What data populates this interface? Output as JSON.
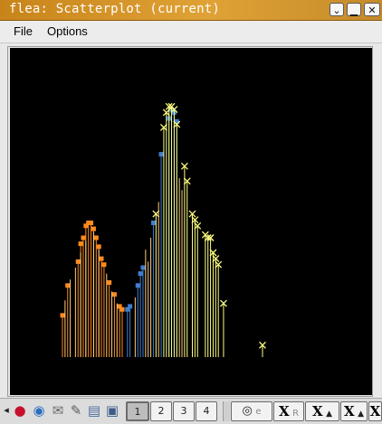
{
  "window": {
    "title": "flea: Scatterplot (current)",
    "buttons": [
      "help",
      "minimize",
      "maximize",
      "close"
    ]
  },
  "menu": {
    "file": "File",
    "options": "Options"
  },
  "chart_data": {
    "type": "scatter",
    "style": "points-with-drop-lines",
    "background": "#000000",
    "baseline_y": 0,
    "xlim": [
      0,
      100
    ],
    "ylim": [
      0,
      100
    ],
    "series": [
      {
        "group": "orange",
        "color": "#ff8a1f",
        "marker": "square",
        "points": [
          [
            0,
            14
          ],
          [
            2,
            24
          ],
          [
            6,
            32
          ],
          [
            7,
            38
          ],
          [
            8,
            40
          ],
          [
            9,
            44
          ],
          [
            10,
            45
          ],
          [
            11,
            45
          ],
          [
            12,
            43
          ],
          [
            13,
            40
          ],
          [
            14,
            37
          ],
          [
            15,
            33
          ],
          [
            16,
            31
          ],
          [
            18,
            25
          ],
          [
            20,
            21
          ],
          [
            22,
            17
          ],
          [
            23,
            16
          ]
        ]
      },
      {
        "group": "blue",
        "color": "#3f7fd0",
        "marker": "square",
        "points": [
          [
            25,
            16
          ],
          [
            26,
            17
          ],
          [
            29,
            24
          ],
          [
            30,
            28
          ],
          [
            31,
            30
          ],
          [
            35,
            45
          ],
          [
            38,
            68
          ],
          [
            41,
            80
          ],
          [
            42,
            83
          ],
          [
            43,
            82
          ],
          [
            44,
            79
          ]
        ]
      },
      {
        "group": "yellow",
        "color": "#ffff80",
        "marker": "cross",
        "points": [
          [
            36,
            48
          ],
          [
            39,
            77
          ],
          [
            40,
            82
          ],
          [
            41,
            84
          ],
          [
            42,
            84
          ],
          [
            43,
            83
          ],
          [
            44,
            78
          ],
          [
            47,
            64
          ],
          [
            48,
            59
          ],
          [
            50,
            48
          ],
          [
            51,
            46
          ],
          [
            52,
            44
          ],
          [
            55,
            41
          ],
          [
            56,
            40
          ],
          [
            57,
            40
          ],
          [
            58,
            35
          ],
          [
            59,
            33
          ],
          [
            60,
            31
          ],
          [
            62,
            18
          ],
          [
            77,
            4
          ]
        ]
      },
      {
        "group": "peach",
        "color": "#ffce80",
        "marker": "none",
        "points": [
          [
            1,
            19
          ],
          [
            3,
            26
          ],
          [
            5,
            30
          ],
          [
            7,
            35
          ],
          [
            9,
            39
          ],
          [
            12,
            42
          ],
          [
            14,
            36
          ],
          [
            17,
            28
          ],
          [
            19,
            22
          ],
          [
            21,
            18
          ],
          [
            28,
            20
          ],
          [
            32,
            36
          ],
          [
            33,
            32
          ],
          [
            34,
            40
          ],
          [
            37,
            52
          ],
          [
            45,
            60
          ],
          [
            46,
            56
          ]
        ]
      }
    ]
  },
  "toolbar": {
    "items": [
      {
        "name": "scroll-left-arrow",
        "glyph": "◂"
      },
      {
        "name": "redhat-icon",
        "glyph": "●"
      },
      {
        "name": "globe-icon",
        "glyph": "◉"
      },
      {
        "name": "mail-icon",
        "glyph": "✉"
      },
      {
        "name": "tools-icon",
        "glyph": "✎"
      },
      {
        "name": "documents-icon",
        "glyph": "▤"
      },
      {
        "name": "monitor-icon",
        "glyph": "▣"
      },
      {
        "name": "printer-icon",
        "glyph": "⎙"
      }
    ],
    "pager": [
      "1",
      "2",
      "3",
      "4"
    ],
    "right_labels": {
      "e": "e",
      "x1": "X",
      "r": "R",
      "x2": "X",
      "x3": "X",
      "x4": "X"
    }
  }
}
